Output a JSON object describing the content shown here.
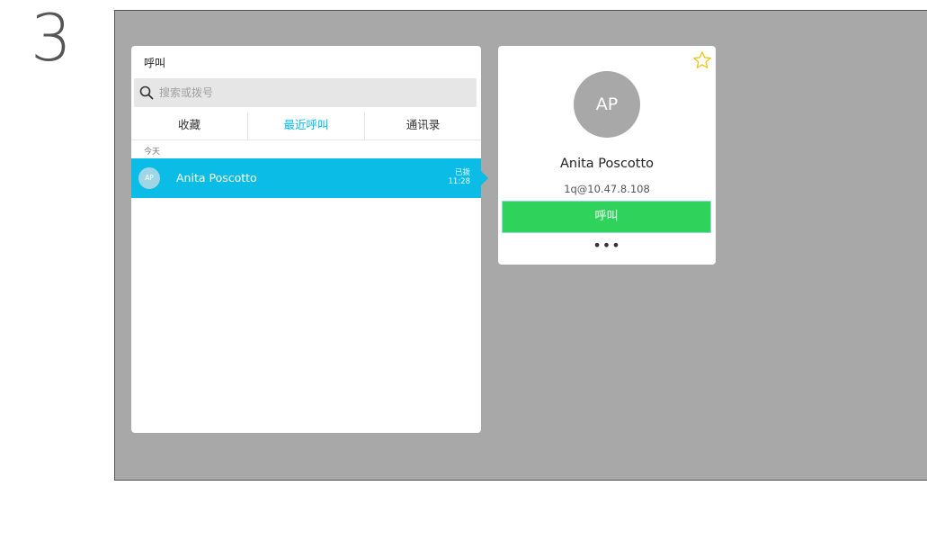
{
  "step": {
    "number": "3"
  },
  "call_panel": {
    "title": "呼叫",
    "search": {
      "placeholder": "搜索或拨号",
      "value": ""
    },
    "tabs": [
      {
        "label": "收藏",
        "active": false
      },
      {
        "label": "最近呼叫",
        "active": true
      },
      {
        "label": "通讯录",
        "active": false
      }
    ],
    "section_label": "今天",
    "recent_calls": [
      {
        "initials": "AP",
        "name": "Anita Poscotto",
        "status": "已拨",
        "time": "11:28",
        "selected": true
      }
    ]
  },
  "contact_card": {
    "initials": "AP",
    "name": "Anita Poscotto",
    "address": "1q@10.47.8.108",
    "call_label": "呼叫",
    "more_label": "•••",
    "star_icon": "star-outline-icon"
  },
  "colors": {
    "accent": "#00bceb",
    "selected_row": "#0bbde6",
    "call_button": "#2fd25b",
    "screen_background": "#a8a8a8",
    "star": "#f0c000"
  }
}
